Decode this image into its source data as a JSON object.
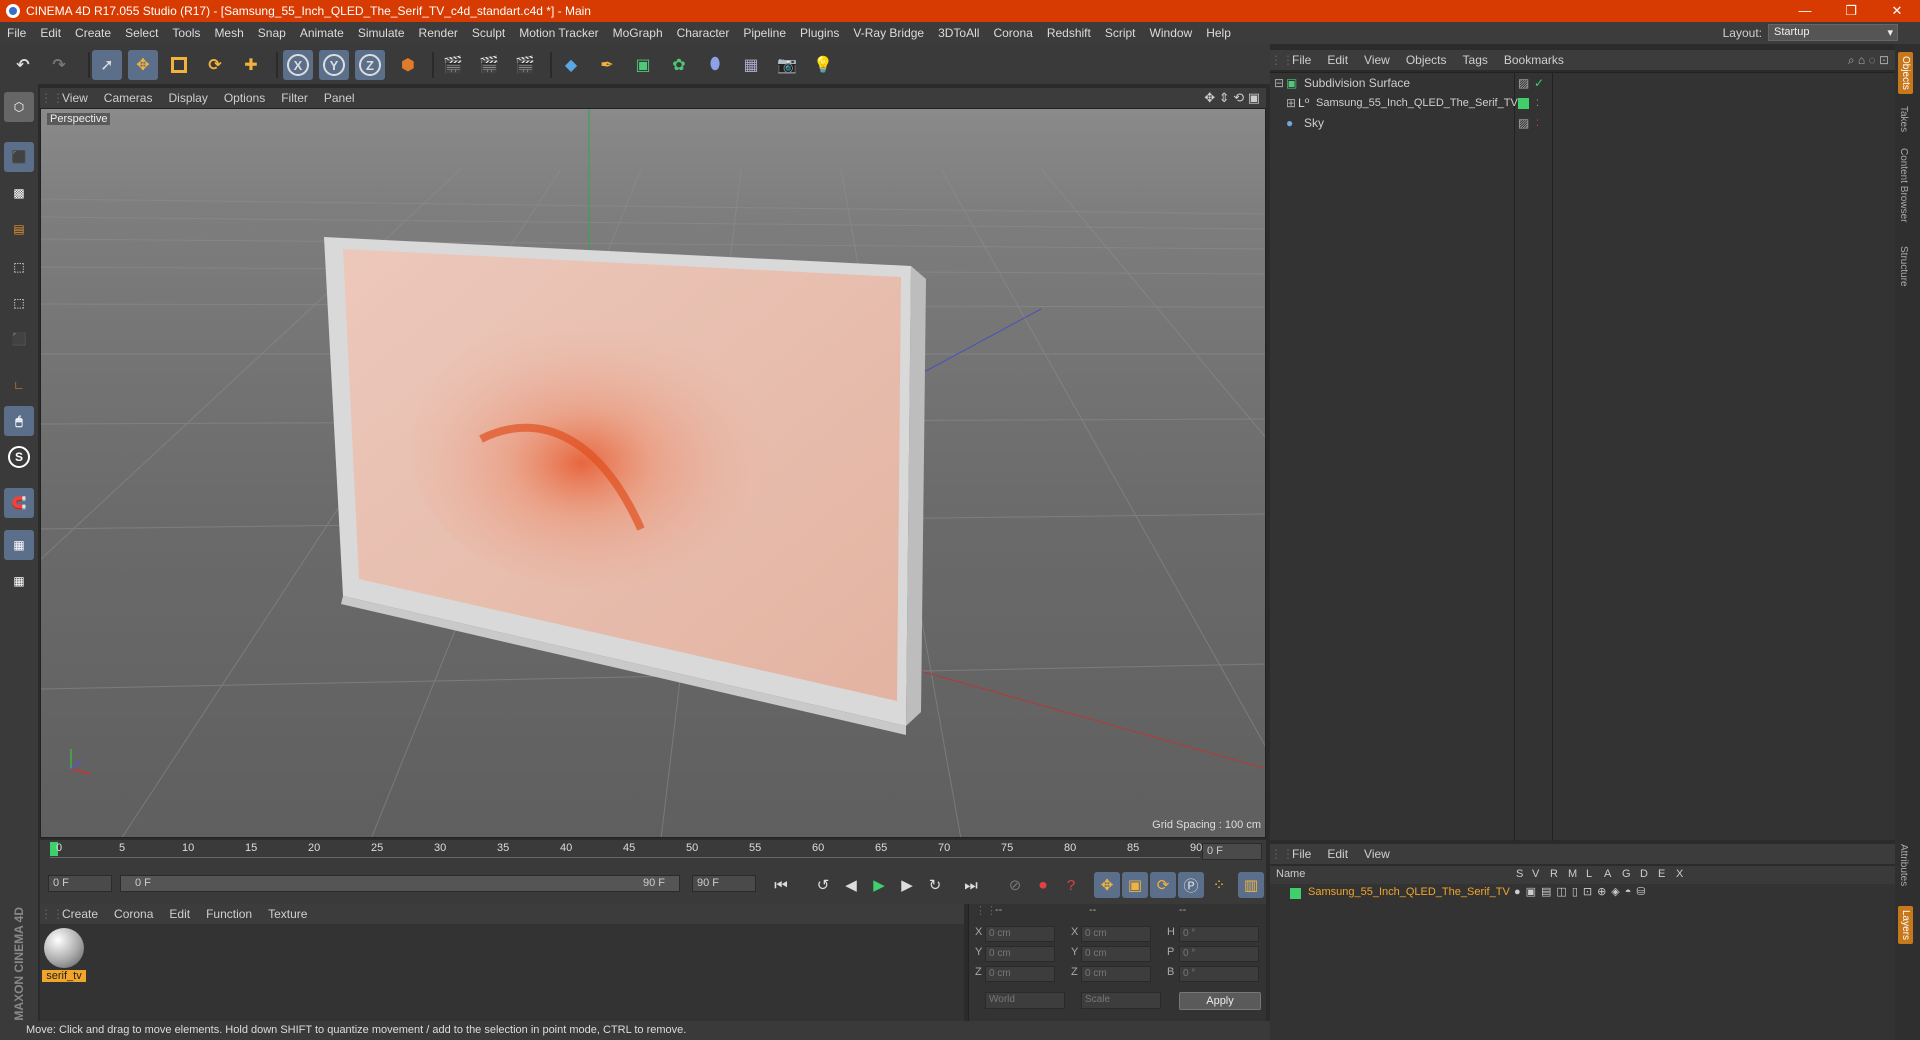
{
  "titlebar": {
    "title": "CINEMA 4D R17.055 Studio (R17) - [Samsung_55_Inch_QLED_The_Serif_TV_c4d_standart.c4d *] - Main",
    "min": "—",
    "max": "❐",
    "close": "✕"
  },
  "menubar": {
    "items": [
      "File",
      "Edit",
      "Create",
      "Select",
      "Tools",
      "Mesh",
      "Snap",
      "Animate",
      "Simulate",
      "Render",
      "Sculpt",
      "Motion Tracker",
      "MoGraph",
      "Character",
      "Pipeline",
      "Plugins",
      "V-Ray Bridge",
      "3DToAll",
      "Corona",
      "Redshift",
      "Script",
      "Window",
      "Help"
    ],
    "layout_label": "Layout:",
    "layout_value": "Startup"
  },
  "toolbar": {
    "x_label": "X",
    "y_label": "Y",
    "z_label": "Z"
  },
  "viewport": {
    "menu": [
      "View",
      "Cameras",
      "Display",
      "Options",
      "Filter",
      "Panel"
    ],
    "label": "Perspective",
    "grid_spacing": "Grid Spacing : 100 cm"
  },
  "timeline": {
    "ticks": [
      "0",
      "5",
      "10",
      "15",
      "20",
      "25",
      "30",
      "35",
      "40",
      "45",
      "50",
      "55",
      "60",
      "65",
      "70",
      "75",
      "80",
      "85",
      "90"
    ],
    "current_frame": "0 F"
  },
  "transport": {
    "start_field": "0 F",
    "range_start": "0 F",
    "range_end": "90 F",
    "end_field": "90 F"
  },
  "materials": {
    "menu": [
      "Create",
      "Corona",
      "Edit",
      "Function",
      "Texture"
    ],
    "material_name": "serif_tv"
  },
  "coords": {
    "headers": [
      "--",
      "--",
      "--"
    ],
    "rows": [
      {
        "a": "X",
        "av": "0 cm",
        "b": "X",
        "bv": "0 cm",
        "c": "H",
        "cv": "0 °"
      },
      {
        "a": "Y",
        "av": "0 cm",
        "b": "Y",
        "bv": "0 cm",
        "c": "P",
        "cv": "0 °"
      },
      {
        "a": "Z",
        "av": "0 cm",
        "b": "Z",
        "bv": "0 cm",
        "c": "B",
        "cv": "0 °"
      }
    ],
    "mode": "World",
    "scale": "Scale",
    "apply": "Apply"
  },
  "objects": {
    "menu": [
      "File",
      "Edit",
      "View",
      "Objects",
      "Tags",
      "Bookmarks"
    ],
    "items": [
      "Subdivision Surface",
      "Samsung_55_Inch_QLED_The_Serif_TV",
      "Sky"
    ]
  },
  "layers": {
    "menu": [
      "File",
      "Edit",
      "View"
    ],
    "name_header": "Name",
    "cols": [
      "S",
      "V",
      "R",
      "M",
      "L",
      "A",
      "G",
      "D",
      "E",
      "X"
    ],
    "row": "Samsung_55_Inch_QLED_The_Serif_TV"
  },
  "right_tabs": [
    "Objects",
    "Takes",
    "Content Browser",
    "Structure",
    "Attributes",
    "Layers"
  ],
  "status": "Move: Click and drag to move elements. Hold down SHIFT to quantize movement / add to the selection in point mode, CTRL to remove.",
  "brand": "MAXON CINEMA 4D"
}
